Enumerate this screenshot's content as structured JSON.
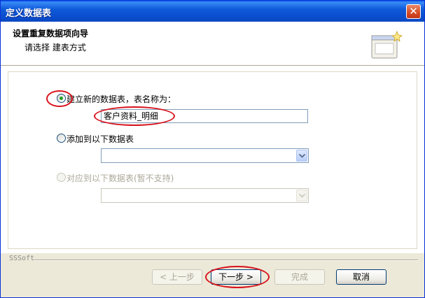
{
  "window": {
    "title": "定义数据表",
    "close_glyph": "✕"
  },
  "header": {
    "title": "设置重复数据项向导",
    "subtitle": "请选择 建表方式"
  },
  "options": [
    {
      "label": "建立新的数据表，表名称为：",
      "checked": true,
      "enabled": true
    },
    {
      "label": "添加到以下数据表",
      "checked": false,
      "enabled": true
    },
    {
      "label": "对应到以下数据表(暂不支持)",
      "checked": false,
      "enabled": false
    }
  ],
  "table_name_input": {
    "value": "客户资料_明细"
  },
  "combo_existing": {
    "value": ""
  },
  "combo_mapping": {
    "value": ""
  },
  "footer": {
    "brand": "SSSoft"
  },
  "buttons": {
    "back": "< 上一步",
    "next": "下一步 >",
    "finish": "完成",
    "cancel": "取消"
  },
  "colors": {
    "title_bar": "#0a4ccc",
    "highlight_annotation": "#d8121b",
    "dialog_bg": "#ece9d8"
  }
}
